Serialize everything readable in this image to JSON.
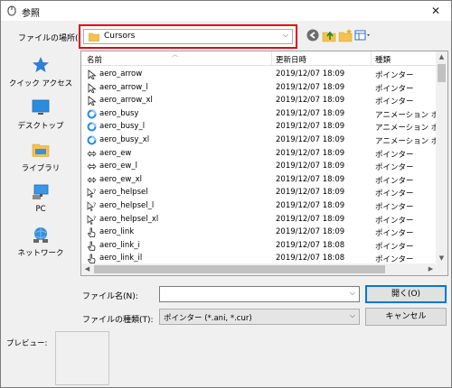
{
  "window": {
    "title": "参照",
    "close_glyph": "✕"
  },
  "location": {
    "label": "ファイルの場所(I):",
    "value": "Cursors"
  },
  "toolbar": {
    "icons": [
      "back-icon",
      "up-folder-icon",
      "new-folder-icon",
      "view-menu-icon"
    ]
  },
  "places": [
    {
      "label": "クイック アクセス",
      "icon": "star-icon"
    },
    {
      "label": "デスクトップ",
      "icon": "desktop-icon"
    },
    {
      "label": "ライブラリ",
      "icon": "library-icon"
    },
    {
      "label": "PC",
      "icon": "pc-icon"
    },
    {
      "label": "ネットワーク",
      "icon": "network-icon"
    }
  ],
  "columns": {
    "name": "名前",
    "date": "更新日時",
    "type": "種類"
  },
  "files": [
    {
      "name": "aero_arrow",
      "date": "2019/12/07 18:09",
      "type": "ポインター",
      "icon": "arrow-cursor-icon"
    },
    {
      "name": "aero_arrow_l",
      "date": "2019/12/07 18:09",
      "type": "ポインター",
      "icon": "arrow-cursor-icon"
    },
    {
      "name": "aero_arrow_xl",
      "date": "2019/12/07 18:09",
      "type": "ポインター",
      "icon": "arrow-cursor-icon"
    },
    {
      "name": "aero_busy",
      "date": "2019/12/07 18:09",
      "type": "アニメーション ポインター",
      "icon": "busy-cursor-icon"
    },
    {
      "name": "aero_busy_l",
      "date": "2019/12/07 18:09",
      "type": "アニメーション ポインター",
      "icon": "busy-cursor-icon"
    },
    {
      "name": "aero_busy_xl",
      "date": "2019/12/07 18:09",
      "type": "アニメーション ポインター",
      "icon": "busy-cursor-icon"
    },
    {
      "name": "aero_ew",
      "date": "2019/12/07 18:09",
      "type": "ポインター",
      "icon": "resize-ew-cursor-icon"
    },
    {
      "name": "aero_ew_l",
      "date": "2019/12/07 18:09",
      "type": "ポインター",
      "icon": "resize-ew-cursor-icon"
    },
    {
      "name": "aero_ew_xl",
      "date": "2019/12/07 18:09",
      "type": "ポインター",
      "icon": "resize-ew-cursor-icon"
    },
    {
      "name": "aero_helpsel",
      "date": "2019/12/07 18:09",
      "type": "ポインター",
      "icon": "help-cursor-icon"
    },
    {
      "name": "aero_helpsel_l",
      "date": "2019/12/07 18:09",
      "type": "ポインター",
      "icon": "help-cursor-icon"
    },
    {
      "name": "aero_helpsel_xl",
      "date": "2019/12/07 18:09",
      "type": "ポインター",
      "icon": "help-cursor-icon"
    },
    {
      "name": "aero_link",
      "date": "2019/12/07 18:09",
      "type": "ポインター",
      "icon": "hand-cursor-icon"
    },
    {
      "name": "aero_link_i",
      "date": "2019/12/07 18:08",
      "type": "ポインター",
      "icon": "hand-cursor-icon"
    },
    {
      "name": "aero_link_il",
      "date": "2019/12/07 18:08",
      "type": "ポインター",
      "icon": "hand-cursor-icon"
    }
  ],
  "filename": {
    "label": "ファイル名(N):",
    "value": "",
    "placeholder": ""
  },
  "filetype": {
    "label": "ファイルの種類(T):",
    "value": "ポインター (*.ani, *.cur)"
  },
  "buttons": {
    "open": "開く(O)",
    "cancel": "キャンセル"
  },
  "preview": {
    "label": "プレビュー:"
  },
  "colors": {
    "highlight": "#e6000a",
    "accent": "#0078d7"
  }
}
